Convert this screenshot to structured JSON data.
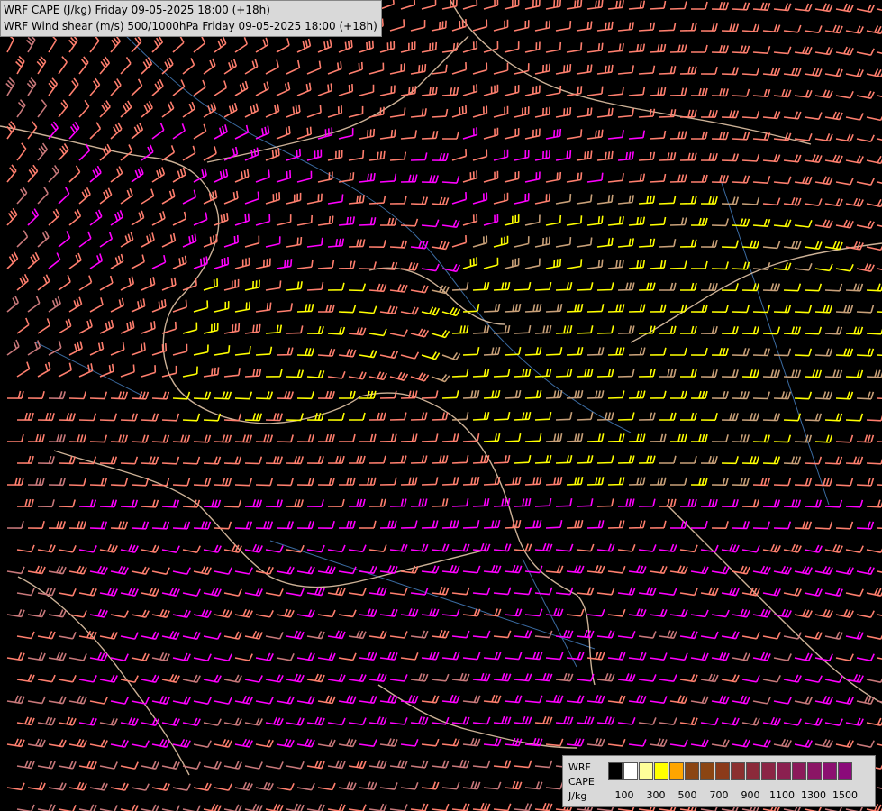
{
  "titles": {
    "line1": "WRF CAPE (J/kg) Friday 09-05-2025 18:00 (+18h)",
    "line2": "WRF Wind shear (m/s) 500/1000hPa Friday 09-05-2025 18:00 (+18h)"
  },
  "legend": {
    "label_model": "WRF",
    "label_var": "CAPE",
    "label_unit": "J/kg",
    "swatch_colors": [
      "#000000",
      "#ffffff",
      "#ffff99",
      "#ffff00",
      "#ffa500",
      "#8b4513",
      "#8b4513",
      "#8b3a1a",
      "#8b2f2f",
      "#8b2a3a",
      "#8b2545",
      "#8b2050",
      "#8b1a5a",
      "#8b1565",
      "#8b1070",
      "#8b0a7a"
    ],
    "tick_labels": [
      "100",
      "300",
      "500",
      "700",
      "900",
      "1100",
      "1300",
      "1500"
    ]
  },
  "colors": {
    "background": "#000000",
    "barb_magenta": "#ff00ff",
    "barb_salmon": "#ff7f6e",
    "barb_rose": "#c8787a",
    "barb_yellow": "#ffff00",
    "barb_tan": "#c8a078",
    "border": "#f0d0b0",
    "river": "#3a6aa0"
  }
}
